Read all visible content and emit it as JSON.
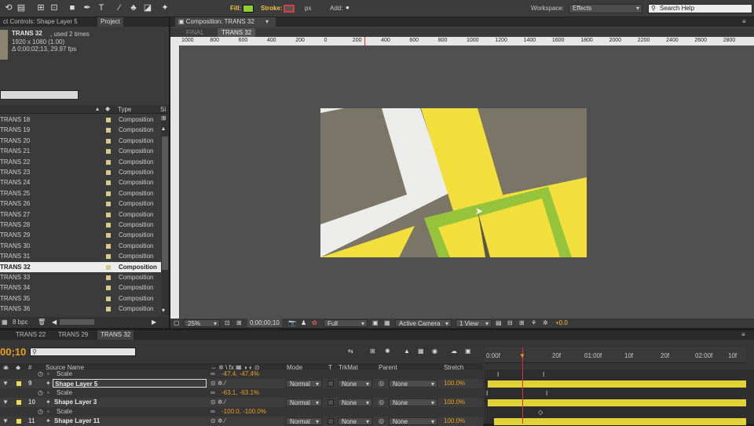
{
  "toolbar": {
    "fill_label": "Fill:",
    "stroke_label": "Stroke:",
    "px_label": "px",
    "add_label": "Add:",
    "workspace_label": "Workspace:",
    "workspace_value": "Effects",
    "search_placeholder": "Search Help",
    "fill_color": "#8fd02b",
    "stroke_color": "#d64040"
  },
  "left_panel": {
    "tabs": [
      "ct Controls: Shape Layer 5",
      "Project"
    ],
    "project_name": "TRANS 32",
    "used_text": ", used 2 times",
    "dimensions": "1920 x 1080 (1.00)",
    "duration": "Δ 0;00;02;13, 29.97 fps",
    "col_type": "Type",
    "col_size": "Si",
    "items": [
      {
        "name": "TRANS 18",
        "type": "Composition"
      },
      {
        "name": "TRANS 19",
        "type": "Composition"
      },
      {
        "name": "TRANS 20",
        "type": "Composition"
      },
      {
        "name": "TRANS 21",
        "type": "Composition"
      },
      {
        "name": "TRANS 22",
        "type": "Composition"
      },
      {
        "name": "TRANS 23",
        "type": "Composition"
      },
      {
        "name": "TRANS 24",
        "type": "Composition"
      },
      {
        "name": "TRANS 25",
        "type": "Composition"
      },
      {
        "name": "TRANS 26",
        "type": "Composition"
      },
      {
        "name": "TRANS 27",
        "type": "Composition"
      },
      {
        "name": "TRANS 28",
        "type": "Composition"
      },
      {
        "name": "TRANS 29",
        "type": "Composition"
      },
      {
        "name": "TRANS 30",
        "type": "Composition"
      },
      {
        "name": "TRANS 31",
        "type": "Composition"
      },
      {
        "name": "TRANS 32",
        "type": "Composition"
      },
      {
        "name": "TRANS 33",
        "type": "Composition"
      },
      {
        "name": "TRANS 34",
        "type": "Composition"
      },
      {
        "name": "TRANS 35",
        "type": "Composition"
      },
      {
        "name": "TRANS 36",
        "type": "Composition"
      }
    ],
    "selected_index": 14,
    "bpc": "8 bpc"
  },
  "composition": {
    "tab": "Composition: TRANS 32",
    "breadcrumb_final": "FINAL",
    "breadcrumb_current": "TRANS 32",
    "ruler": [
      "1000",
      "800",
      "600",
      "400",
      "200",
      "0",
      "200",
      "400",
      "600",
      "800",
      "1000",
      "1200",
      "1400",
      "1600",
      "1800",
      "2000",
      "2200",
      "2400",
      "2600",
      "2800"
    ],
    "footer": {
      "zoom": "25%",
      "timecode": "0;00;00;10",
      "resolution": "Full",
      "camera": "Active Camera",
      "view": "1 View",
      "exposure": "+0.0"
    }
  },
  "timeline": {
    "tabs": [
      "TRANS 22",
      "TRANS 29",
      "TRANS 32"
    ],
    "active_tab": 2,
    "timecode": "00;10",
    "headers": {
      "num": "#",
      "source": "Source Name",
      "mode": "Mode",
      "t": "T",
      "trkmat": "TrkMat",
      "parent": "Parent",
      "stretch": "Stretch"
    },
    "ruler": [
      "0:00f",
      "20f",
      "01:00f",
      "10f",
      "20f",
      "02:00f",
      "10f"
    ],
    "rows": [
      {
        "kind": "prop",
        "name": "Scale",
        "value": "-47.4, -47.4%"
      },
      {
        "kind": "layer",
        "num": "9",
        "name": "Shape Layer 5",
        "mode": "Normal",
        "trkmat": "None",
        "parent": "None",
        "stretch": "100.0%",
        "selected": true
      },
      {
        "kind": "prop",
        "name": "Scale",
        "value": "-63.1, -63.1%"
      },
      {
        "kind": "layer",
        "num": "10",
        "name": "Shape Layer 3",
        "mode": "Normal",
        "trkmat": "None",
        "parent": "None",
        "stretch": "100.0%"
      },
      {
        "kind": "prop",
        "name": "Scale",
        "value": "-100.0, -100.0%"
      },
      {
        "kind": "layer",
        "num": "11",
        "name": "Shape Layer 11",
        "mode": "Normal",
        "trkmat": "None",
        "parent": "None",
        "stretch": "100.0%"
      }
    ]
  }
}
